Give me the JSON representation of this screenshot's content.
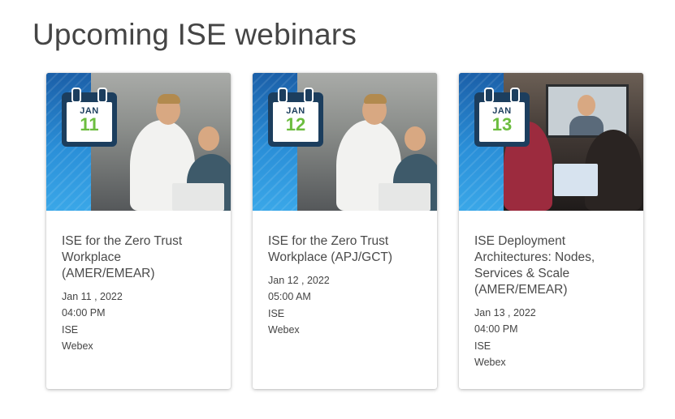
{
  "page": {
    "title": "Upcoming ISE webinars"
  },
  "cards": [
    {
      "calendar": {
        "month": "JAN",
        "day": "11"
      },
      "title": "ISE for the Zero Trust Workplace (AMER/EMEAR)",
      "date": "Jan 11 , 2022",
      "time": "04:00 PM",
      "product": "ISE",
      "platform": "Webex"
    },
    {
      "calendar": {
        "month": "JAN",
        "day": "12"
      },
      "title": "ISE for the Zero Trust Workplace (APJ/GCT)",
      "date": "Jan 12 , 2022",
      "time": "05:00 AM",
      "product": "ISE",
      "platform": "Webex"
    },
    {
      "calendar": {
        "month": "JAN",
        "day": "13"
      },
      "title": "ISE Deployment Architectures: Nodes, Services & Scale (AMER/EMEAR)",
      "date": "Jan 13 , 2022",
      "time": "04:00 PM",
      "product": "ISE",
      "platform": "Webex"
    }
  ],
  "colors": {
    "calendar_navy": "#1c3e5e",
    "calendar_day_green": "#6cbd3f",
    "strip_blue": "#2a8fd8"
  }
}
